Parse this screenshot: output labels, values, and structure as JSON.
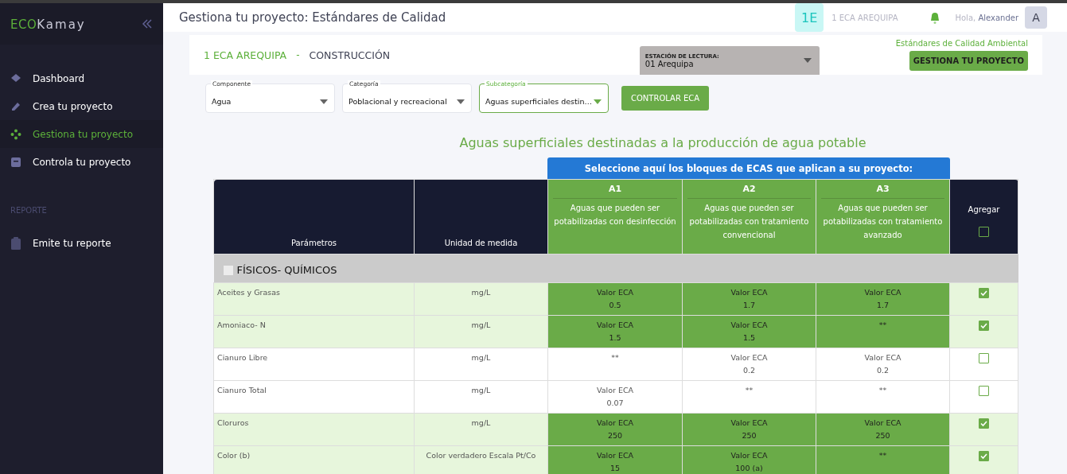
{
  "sidebar": {
    "logo_primary": "ECO",
    "logo_secondary": "Kamay",
    "sections": [
      {
        "items": [
          {
            "label": "Dashboard",
            "selected": false
          },
          {
            "label": "Crea tu proyecto",
            "selected": false
          },
          {
            "label": "Gestiona tu proyecto",
            "selected": true
          },
          {
            "label": "Controla tu proyecto",
            "selected": false
          }
        ]
      },
      {
        "title": "REPORTE",
        "items": [
          {
            "label": "Emite tu reporte",
            "selected": false
          }
        ]
      }
    ]
  },
  "header": {
    "title": "Gestiona tu proyecto: Estándares de Calidad",
    "project_badge": "1E",
    "project_name": "1 ECA AREQUIPA",
    "greeting": "Hola,",
    "user": "Alexander",
    "avatar": "A"
  },
  "project_bar": {
    "project": "1 ECA AREQUIPA",
    "separator": "-",
    "category": "CONSTRUCCIÓN",
    "station": {
      "label": "ESTACIÓN DE LECTURA:",
      "value": "01 Arequipa"
    },
    "caption": "Estándares de Calidad Ambiental",
    "button": "GESTIONA TU PROYECTO"
  },
  "filters": [
    {
      "label": "Componente",
      "value": "Agua",
      "selected": false
    },
    {
      "label": "Categoría",
      "value": "Poblacional y recreacional",
      "selected": false
    },
    {
      "label": "Subcategoría",
      "value": "Aguas superficiales destin…",
      "selected": true
    }
  ],
  "control_button": "CONTROLAR ECA",
  "table": {
    "title": "Aguas superficiales destinadas a la producción de agua potable",
    "banner": "Seleccione aquí los bloques de ECAS que aplican a su proyecto:",
    "columns": {
      "parameter": "Parámetros",
      "unit": "Unidad de medida",
      "add": "Agregar",
      "add_checked": false
    },
    "blocks": [
      {
        "code": "A1",
        "description": "Aguas que pueden ser potabilizadas con desinfección"
      },
      {
        "code": "A2",
        "description": "Aguas que pueden ser potabilizadas con tratamiento convencional"
      },
      {
        "code": "A3",
        "description": "Aguas que pueden ser potabilizadas con tratamiento avanzado"
      }
    ],
    "group": "FÍSICOS- QUÍMICOS",
    "rows": [
      {
        "parameter": "Aceites y Grasas",
        "unit": "mg/L",
        "checked": true,
        "values": [
          {
            "label": "Valor ECA",
            "value": "0.5"
          },
          {
            "label": "Valor ECA",
            "value": "1.7"
          },
          {
            "label": "Valor ECA",
            "value": "1.7"
          }
        ]
      },
      {
        "parameter": "Amoniaco- N",
        "unit": "mg/L",
        "checked": true,
        "values": [
          {
            "label": "Valor ECA",
            "value": "1.5"
          },
          {
            "label": "Valor ECA",
            "value": "1.5"
          },
          {
            "value": "**"
          }
        ]
      },
      {
        "parameter": "Cianuro Libre",
        "unit": "mg/L",
        "checked": false,
        "values": [
          {
            "value": "**"
          },
          {
            "label": "Valor ECA",
            "value": "0.2"
          },
          {
            "label": "Valor ECA",
            "value": "0.2"
          }
        ]
      },
      {
        "parameter": "Cianuro Total",
        "unit": "mg/L",
        "checked": false,
        "values": [
          {
            "label": "Valor ECA",
            "value": "0.07"
          },
          {
            "value": "**"
          },
          {
            "value": "**"
          }
        ]
      },
      {
        "parameter": "Cloruros",
        "unit": "mg/L",
        "checked": true,
        "values": [
          {
            "label": "Valor ECA",
            "value": "250"
          },
          {
            "label": "Valor ECA",
            "value": "250"
          },
          {
            "label": "Valor ECA",
            "value": "250"
          }
        ]
      },
      {
        "parameter": "Color (b)",
        "unit": "Color verdadero Escala Pt/Co",
        "checked": true,
        "values": [
          {
            "label": "Valor ECA",
            "value": "15"
          },
          {
            "label": "Valor ECA",
            "value": "100 (a)"
          },
          {
            "value": "**"
          }
        ]
      }
    ]
  }
}
